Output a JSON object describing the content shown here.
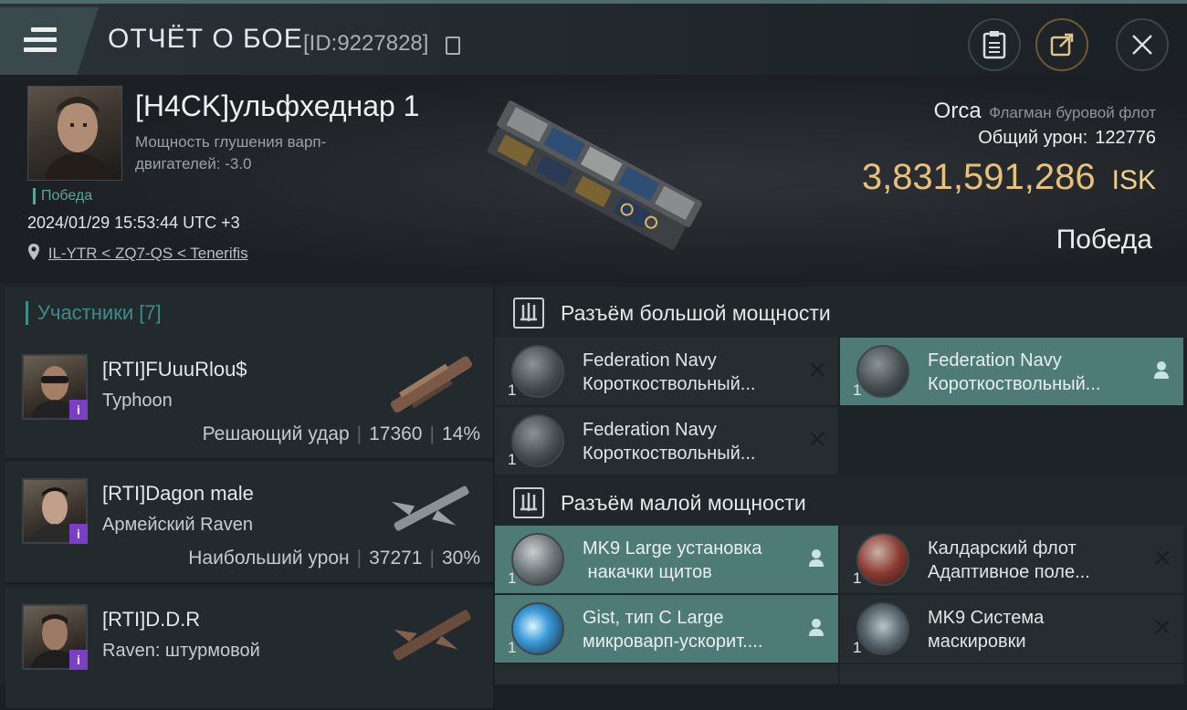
{
  "header": {
    "title": "ОТЧЁТ О БОЕ",
    "report_id": "[ID:9227828]"
  },
  "victim": {
    "name": "[H4CK]ульфхеднар 1",
    "stat": "Мощность глушения варп-двигателей: -3.0",
    "result_tag": "Победа",
    "datetime": "2024/01/29 15:53:44 UTC +3",
    "location": "IL-YTR < ZQ7-QS < Tenerifis",
    "ship_name": "Orca",
    "ship_class": "Флагман буровой флот",
    "total_damage_label": "Общий урон:",
    "total_damage": "122776",
    "isk_value": "3,831,591,286",
    "isk_unit": "ISK",
    "result": "Победа"
  },
  "participants": {
    "header": "Участники [7]",
    "items": [
      {
        "name": "[RTI]FUuuRlou$",
        "ship": "Typhoon",
        "role": "Решающий удар",
        "damage": "17360",
        "percent": "14%"
      },
      {
        "name": "[RTI]Dagon male",
        "ship": "Армейский Raven",
        "role": "Наибольший урон",
        "damage": "37271",
        "percent": "30%"
      },
      {
        "name": "[RTI]D.D.R",
        "ship": "Raven: штурмовой",
        "role": "",
        "damage": "",
        "percent": ""
      }
    ],
    "badge": "i"
  },
  "modules": {
    "high_title": "Разъём большой мощности",
    "low_title": "Разъём малой мощности",
    "high": [
      {
        "line1": "Federation Navy",
        "line2": "Короткоствольный...",
        "qty": "1",
        "status": "destroyed"
      },
      {
        "line1": "Federation Navy",
        "line2": "Короткоствольный...",
        "qty": "1",
        "status": "dropped"
      },
      {
        "line1": "Federation Navy",
        "line2": "Короткоствольный...",
        "qty": "1",
        "status": "destroyed"
      }
    ],
    "low": [
      {
        "line1": "MK9 Large установка",
        "line2": " накачки щитов",
        "qty": "1",
        "status": "dropped"
      },
      {
        "line1": "Калдарский флот",
        "line2": "Адаптивное поле...",
        "qty": "1",
        "status": "destroyed"
      },
      {
        "line1": "Gist, тип C Large",
        "line2": "микроварп-ускорит....",
        "qty": "1",
        "status": "dropped"
      },
      {
        "line1": "MK9 Система",
        "line2": "маскировки",
        "qty": "1",
        "status": "destroyed"
      }
    ]
  },
  "colors": {
    "accent": "#4e7b76",
    "isk": "#e7c07a",
    "victory": "#5fa59a",
    "badge": "#7a3fc4"
  }
}
